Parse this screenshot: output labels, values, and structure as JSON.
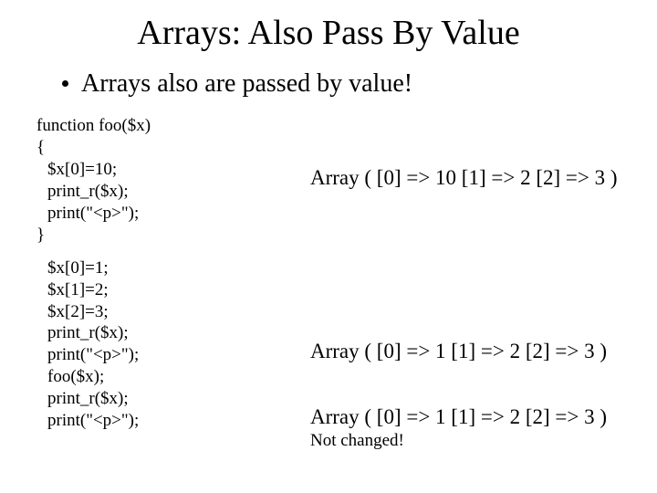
{
  "title": "Arrays: Also Pass By Value",
  "bullet": "Arrays also are passed by value!",
  "code": {
    "l1": "function foo($x)",
    "l2": "{",
    "l3": "$x[0]=10;",
    "l4": "print_r($x);",
    "l5": "print(\"<p>\");",
    "l6": "}",
    "l7": "$x[0]=1;",
    "l8": "$x[1]=2;",
    "l9": "$x[2]=3;",
    "l10": "print_r($x);",
    "l11": "print(\"<p>\");",
    "l12": "foo($x);",
    "l13": "print_r($x);",
    "l14": "print(\"<p>\");"
  },
  "output": {
    "o1": "Array ( [0] => 10 [1] => 2 [2] => 3 )",
    "o2": "Array ( [0] => 1 [1] => 2 [2] => 3 )",
    "o3": "Array ( [0] => 1 [1] => 2 [2] => 3 )",
    "note": "Not changed!"
  }
}
